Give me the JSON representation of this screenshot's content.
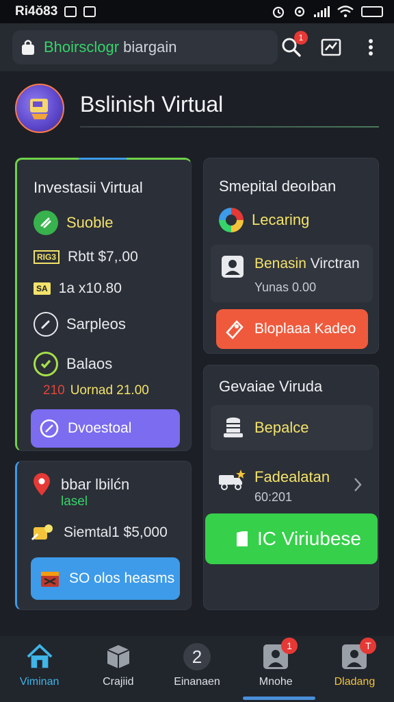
{
  "status": {
    "time": "Ri4ŏ83"
  },
  "top_bar": {
    "search_brand": "Bhoirsclogr",
    "search_rest": "biargain",
    "notif_count": "1"
  },
  "header": {
    "title": "Bslinish Virtual"
  },
  "card_invest": {
    "title": "Investasii Virtual",
    "status_label": "Suoble",
    "price_tag": "RIG3",
    "price_text": "Rbtt $7,.00",
    "qty_tag": "SA",
    "qty_text": "1a x10.80",
    "surplus_label": "Sarpleos",
    "balance_label": "Balaos",
    "balance_prefix": "210",
    "balance_text": "Uornad 21.00",
    "button_label": "Dvoestoal",
    "accent_color": "#6fd24a"
  },
  "card_location": {
    "title": "bbar lbilćn",
    "subtitle": "lasel",
    "amount_text": "Siemtal1 $5,000",
    "button_label": "SO olos heasms"
  },
  "card_learning": {
    "title": "Smepital deoıban",
    "learning_label": "Lecaring",
    "item_title_yellow": "Benasin",
    "item_title_rest": "Virctran",
    "item_sub": "Yunas 0.00",
    "button_label": "Bloplaaa Kadeo"
  },
  "card_virtual": {
    "title": "Gevaiae Viruda",
    "balance_label": "Bepalce",
    "item_title": "Fadealatan",
    "item_sub": "60:201",
    "button_label": "IC Viriubese"
  },
  "nav": {
    "items": [
      {
        "label": "Viminan",
        "active": true
      },
      {
        "label": "Crajiid"
      },
      {
        "label": "Einanaen",
        "icon_text": "2"
      },
      {
        "label": "Mnohe",
        "badge": "1"
      },
      {
        "label": "Dladang",
        "badge": "T"
      }
    ]
  },
  "colors": {
    "accent_green": "#35d46a",
    "purple_button": "#7b6cf0",
    "blue_button": "#3d9be9",
    "red_button": "#ef5a3c",
    "green_button": "#36d04a"
  }
}
